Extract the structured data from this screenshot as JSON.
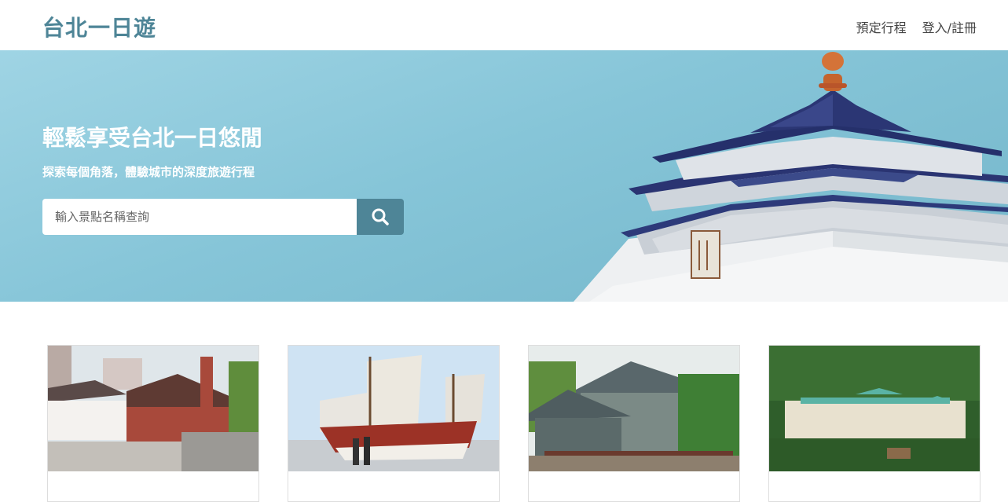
{
  "header": {
    "brand": "台北一日遊",
    "nav": [
      {
        "label": "預定行程"
      },
      {
        "label": "登入/註冊"
      }
    ]
  },
  "hero": {
    "title": "輕鬆享受台北一日悠閒",
    "subtitle": "探索每個角落，體驗城市的深度旅遊行程",
    "search": {
      "placeholder": "輸入景點名稱查詢",
      "value": "",
      "button_icon": "search-icon"
    }
  },
  "attractions": [
    {
      "title": "",
      "photo": "red-brick-building"
    },
    {
      "title": "",
      "photo": "sailing-ship"
    },
    {
      "title": "",
      "photo": "grey-stone-house"
    },
    {
      "title": "",
      "photo": "palace-museum"
    }
  ],
  "colors": {
    "brand": "#4e8597",
    "hero_gradient_start": "#9fd4e4",
    "hero_gradient_end": "#74b6ca",
    "search_button": "#4e8597"
  }
}
